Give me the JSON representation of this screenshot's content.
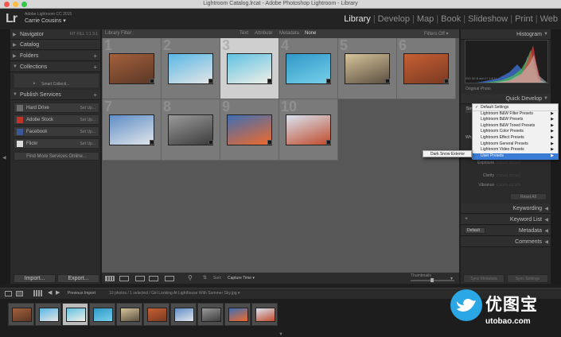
{
  "window": {
    "title": "Lightroom Catalog.lrcat - Adobe Photoshop Lightroom - Library"
  },
  "identity": {
    "logo": "Lr",
    "product": "Adobe Lightroom CC 2015",
    "user": "Carrie Cousins ▾"
  },
  "modules": [
    "Library",
    "Develop",
    "Map",
    "Book",
    "Slideshow",
    "Print",
    "Web"
  ],
  "left_panel": {
    "navigator": "Navigator",
    "navigator_options": "FIT  FILL  1:1  3:1",
    "catalog": "Catalog",
    "folders": "Folders",
    "collections": "Collections",
    "smart_collections": "Smart Collecti...",
    "publish_services": "Publish Services",
    "services": [
      {
        "name": "Hard Drive",
        "setup": "Set Up...",
        "color": "#6b6b6b"
      },
      {
        "name": "Adobe Stock",
        "setup": "Set Up...",
        "color": "#c0332b"
      },
      {
        "name": "Facebook",
        "setup": "Set Up...",
        "color": "#3b5998"
      },
      {
        "name": "Flickr",
        "setup": "Set Up...",
        "color": "#dcdcdc"
      }
    ],
    "find_more": "Find More Services Online...",
    "import": "Import...",
    "export": "Export..."
  },
  "library_filter": {
    "label": "Library Filter :",
    "options": [
      "Text",
      "Attribute",
      "Metadata",
      "None"
    ],
    "active": "None",
    "filters_off": "Filters Off ▾"
  },
  "grid": {
    "cells": [
      {
        "num": "1",
        "selected": false,
        "colors": [
          "#a3603c",
          "#5b3726"
        ]
      },
      {
        "num": "2",
        "selected": false,
        "colors": [
          "#58b7e6",
          "#e6e6e6"
        ]
      },
      {
        "num": "3",
        "selected": true,
        "colors": [
          "#5fc2e4",
          "#f2efe6"
        ]
      },
      {
        "num": "4",
        "selected": false,
        "colors": [
          "#2f98c8",
          "#78d0ea"
        ]
      },
      {
        "num": "5",
        "selected": false,
        "colors": [
          "#d6c49a",
          "#5b4f40"
        ]
      },
      {
        "num": "6",
        "selected": false,
        "colors": [
          "#c75f34",
          "#7a3a22"
        ]
      },
      {
        "num": "7",
        "selected": false,
        "colors": [
          "#5e8dc7",
          "#e2e6ea"
        ]
      },
      {
        "num": "8",
        "selected": false,
        "colors": [
          "#9a9a9a",
          "#3c3c3c"
        ]
      },
      {
        "num": "9",
        "selected": false,
        "colors": [
          "#3e6fb5",
          "#f06a2a"
        ]
      },
      {
        "num": "10",
        "selected": false,
        "colors": [
          "#d9e4f2",
          "#c14a2a"
        ]
      }
    ]
  },
  "toolbar": {
    "sort_label": "Sort:",
    "sort_value": "Capture Time ▾",
    "thumbnails": "Thumbnails"
  },
  "right_panel": {
    "histogram": "Histogram",
    "hist_info": "ISO 50    8 mm    f / 1.8    1/...",
    "original_photo": "Original Photo",
    "quick_develop": "Quick Develop",
    "preset_short": "Sav",
    "wb_short": "Wh",
    "sliders": [
      "Exposure",
      "Clarity",
      "Vibrance"
    ],
    "reset_all": "Reset All",
    "keywording": "Keywording",
    "keyword_list": "Keyword List",
    "metadata": "Metadata",
    "metadata_preset": "Default",
    "comments": "Comments",
    "sync_metadata": "Sync Metadata",
    "sync_settings": "Sync Settings"
  },
  "preset_menu": {
    "items": [
      {
        "label": "Default Settings",
        "checked": true,
        "submenu": false
      },
      {
        "label": "Lightroom B&W Filter Presets",
        "checked": false,
        "submenu": true
      },
      {
        "label": "Lightroom B&W Presets",
        "checked": false,
        "submenu": true
      },
      {
        "label": "Lightroom B&W Toned Presets",
        "checked": false,
        "submenu": true
      },
      {
        "label": "Lightroom Color Presets",
        "checked": false,
        "submenu": true
      },
      {
        "label": "Lightroom Effect Presets",
        "checked": false,
        "submenu": true
      },
      {
        "label": "Lightroom General Presets",
        "checked": false,
        "submenu": true
      },
      {
        "label": "Lightroom Video Presets",
        "checked": false,
        "submenu": true
      },
      {
        "label": "User Presets",
        "checked": false,
        "submenu": true
      }
    ],
    "submenu_item": "Dark Snow Exterior"
  },
  "filmstrip": {
    "source": "Previous Import",
    "count": "10 photos / 1 selected / Girl Looking At Lighthouse With Summer Sky.jpg ▾"
  },
  "watermark": {
    "title": "优图宝",
    "sub": "utobao.com"
  }
}
